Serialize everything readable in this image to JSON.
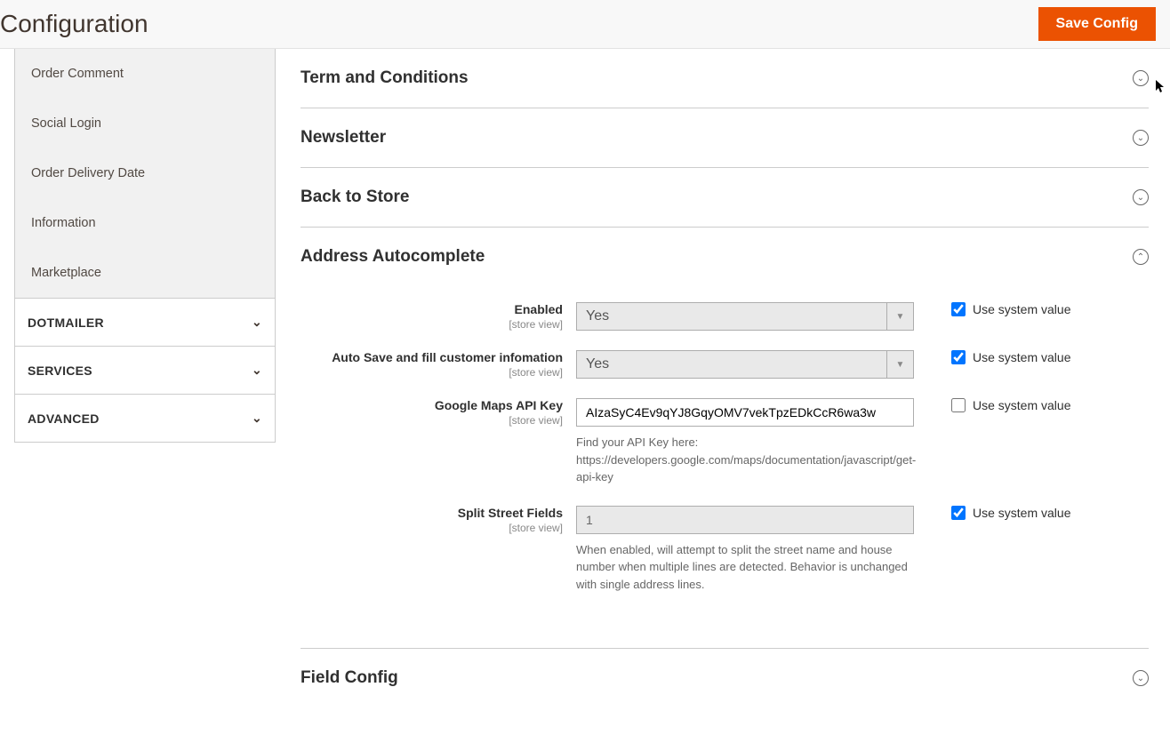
{
  "header": {
    "title": "Configuration",
    "save_label": "Save Config"
  },
  "sidebar": {
    "items": [
      {
        "label": "Order Comment"
      },
      {
        "label": "Social Login"
      },
      {
        "label": "Order Delivery Date"
      },
      {
        "label": "Information"
      },
      {
        "label": "Marketplace"
      }
    ],
    "groups": [
      {
        "label": "DOTMAILER"
      },
      {
        "label": "SERVICES"
      },
      {
        "label": "ADVANCED"
      }
    ]
  },
  "sections": {
    "terms": {
      "title": "Term and Conditions"
    },
    "newsletter": {
      "title": "Newsletter"
    },
    "back_to_store": {
      "title": "Back to Store"
    },
    "address_autocomplete": {
      "title": "Address Autocomplete"
    },
    "field_config": {
      "title": "Field Config"
    }
  },
  "fields": {
    "scope_label": "[store view]",
    "system_label": "Use system value",
    "enabled": {
      "label": "Enabled",
      "value": "Yes"
    },
    "auto_save": {
      "label": "Auto Save and fill customer infomation",
      "value": "Yes"
    },
    "api_key": {
      "label": "Google Maps API Key",
      "value": "AIzaSyC4Ev9qYJ8GqyOMV7vekTpzEDkCcR6wa3w",
      "note": "Find your API Key here: https://developers.google.com/maps/documentation/javascript/get-api-key"
    },
    "split_street": {
      "label": "Split Street Fields",
      "value": "1",
      "note": "When enabled, will attempt to split the street name and house number when multiple lines are detected. Behavior is unchanged with single address lines."
    }
  }
}
